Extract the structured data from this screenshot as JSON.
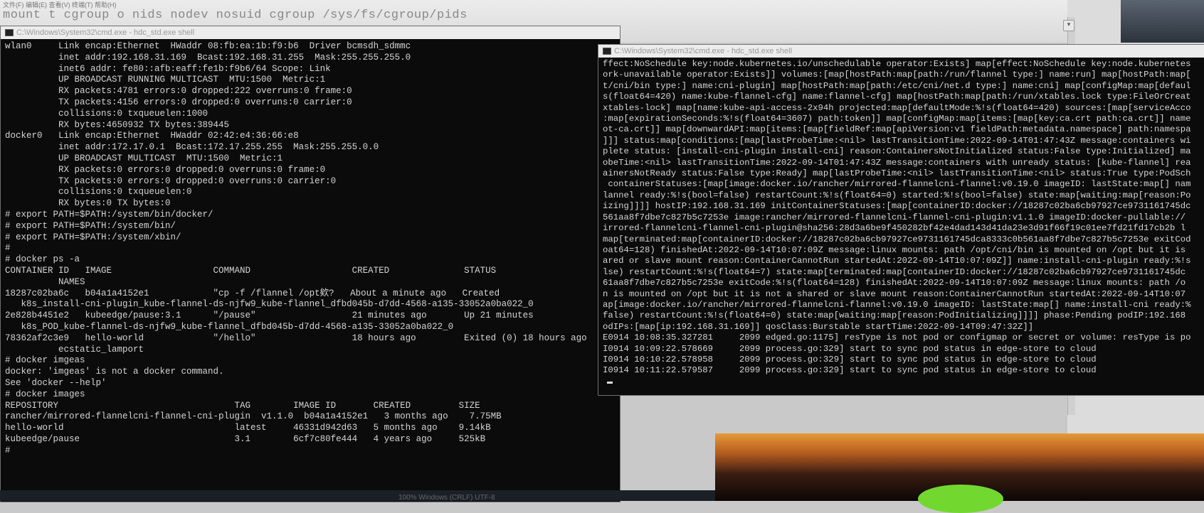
{
  "top": {
    "menu": "文件(F)  编辑(E)  查看(V)  终端(T)  帮助(H)",
    "command_line": "mount  t cgroup  o nids nodev nosuid cgroup /sys/fs/cgroup/pids"
  },
  "window1": {
    "title": "C:\\Windows\\System32\\cmd.exe - hdc_std.exe  shell",
    "lines": [
      "wlan0     Link encap:Ethernet  HWaddr 08:fb:ea:1b:f9:b6  Driver bcmsdh_sdmmc",
      "          inet addr:192.168.31.169  Bcast:192.168.31.255  Mask:255.255.255.0",
      "          inet6 addr: fe80::afb:eaff:fe1b:f9b6/64 Scope: Link",
      "          UP BROADCAST RUNNING MULTICAST  MTU:1500  Metric:1",
      "          RX packets:4781 errors:0 dropped:222 overruns:0 frame:0",
      "          TX packets:4156 errors:0 dropped:0 overruns:0 carrier:0",
      "          collisions:0 txqueuelen:1000",
      "          RX bytes:4650932 TX bytes:389445",
      "",
      "docker0   Link encap:Ethernet  HWaddr 02:42:e4:36:66:e8",
      "          inet addr:172.17.0.1  Bcast:172.17.255.255  Mask:255.255.0.0",
      "          UP BROADCAST MULTICAST  MTU:1500  Metric:1",
      "          RX packets:0 errors:0 dropped:0 overruns:0 frame:0",
      "          TX packets:0 errors:0 dropped:0 overruns:0 carrier:0",
      "          collisions:0 txqueuelen:0",
      "          RX bytes:0 TX bytes:0",
      "",
      "# export PATH=$PATH:/system/bin/docker/",
      "# export PATH=$PATH:/system/bin/",
      "# export PATH=$PATH:/system/xbin/",
      "#",
      "# docker ps -a",
      "CONTAINER ID   IMAGE                   COMMAND                   CREATED              STATUS",
      "          NAMES",
      "18287c02ba6c   b04a1a4152e1            \"cp -f /flannel /opt欸?   About a minute ago   Created",
      "   k8s_install-cni-plugin_kube-flannel-ds-njfw9_kube-flannel_dfbd045b-d7dd-4568-a135-33052a0ba022_0",
      "2e828b4451e2   kubeedge/pause:3.1      \"/pause\"                  21 minutes ago       Up 21 minutes",
      "   k8s_POD_kube-flannel-ds-njfw9_kube-flannel_dfbd045b-d7dd-4568-a135-33052a0ba022_0",
      "78362af2c3e9   hello-world             \"/hello\"                  18 hours ago         Exited (0) 18 hours ago",
      "          ecstatic_lamport",
      "# docker imgeas",
      "docker: 'imgeas' is not a docker command.",
      "See 'docker --help'",
      "# docker images",
      "REPOSITORY                                 TAG        IMAGE ID       CREATED         SIZE",
      "rancher/mirrored-flannelcni-flannel-cni-plugin  v1.1.0  b04a1a4152e1   3 months ago    7.75MB",
      "hello-world                                latest     46331d942d63   5 months ago    9.14kB",
      "kubeedge/pause                             3.1        6cf7c80fe444   4 years ago     525kB",
      "#"
    ]
  },
  "window2": {
    "title": "C:\\Windows\\System32\\cmd.exe - hdc_std.exe  shell",
    "lines": [
      "ffect:NoSchedule key:node.kubernetes.io/unschedulable operator:Exists] map[effect:NoSchedule key:node.kubernetes",
      "ork-unavailable operator:Exists]] volumes:[map[hostPath:map[path:/run/flannel type:] name:run] map[hostPath:map[",
      "t/cni/bin type:] name:cni-plugin] map[hostPath:map[path:/etc/cni/net.d type:] name:cni] map[configMap:map[defaul",
      "s(float64=420) name:kube-flannel-cfg] name:flannel-cfg] map[hostPath:map[path:/run/xtables.lock type:FileOrCreat",
      "xtables-lock] map[name:kube-api-access-2x94h projected:map[defaultMode:%!s(float64=420) sources:[map[serviceAcco",
      ":map[expirationSeconds:%!s(float64=3607) path:token]] map[configMap:map[items:[map[key:ca.crt path:ca.crt]] name",
      "ot-ca.crt]] map[downwardAPI:map[items:[map[fieldRef:map[apiVersion:v1 fieldPath:metadata.namespace] path:namespa",
      "]]] status:map[conditions:[map[lastProbeTime:<nil> lastTransitionTime:2022-09-14T01:47:43Z message:containers wi",
      "plete status: [install-cni-plugin install-cni] reason:ContainersNotInitialized status:False type:Initialized] ma",
      "obeTime:<nil> lastTransitionTime:2022-09-14T01:47:43Z message:containers with unready status: [kube-flannel] rea",
      "ainersNotReady status:False type:Ready] map[lastProbeTime:<nil> lastTransitionTime:<nil> status:True type:PodSch",
      " containerStatuses:[map[image:docker.io/rancher/mirrored-flannelcni-flannel:v0.19.0 imageID: lastState:map[] nam",
      "lannel ready:%!s(bool=false) restartCount:%!s(float64=0) started:%!s(bool=false) state:map[waiting:map[reason:Po",
      "izing]]]] hostIP:192.168.31.169 initContainerStatuses:[map[containerID:docker://18287c02ba6cb97927ce9731161745dc",
      "561aa8f7dbe7c827b5c7253e image:rancher/mirrored-flannelcni-flannel-cni-plugin:v1.1.0 imageID:docker-pullable://",
      "irrored-flannelcni-flannel-cni-plugin@sha256:28d3a6be9f450282bf42e4dad143d41da23e3d91f66f19c01ee7fd21fd17cb2b l",
      "map[terminated:map[containerID:docker://18287c02ba6cb97927ce9731161745dca8333c0b561aa8f7dbe7c827b5c7253e exitCod",
      "oat64=128) finishedAt:2022-09-14T10:07:09Z message:linux mounts: path /opt/cni/bin is mounted on /opt but it is",
      "ared or slave mount reason:ContainerCannotRun startedAt:2022-09-14T10:07:09Z]] name:install-cni-plugin ready:%!s",
      "lse) restartCount:%!s(float64=7) state:map[terminated:map[containerID:docker://18287c02ba6cb97927ce9731161745dc",
      "61aa8f7dbe7c827b5c7253e exitCode:%!s(float64=128) finishedAt:2022-09-14T10:07:09Z message:linux mounts: path /o",
      "n is mounted on /opt but it is not a shared or slave mount reason:ContainerCannotRun startedAt:2022-09-14T10:07",
      "ap[image:docker.io/rancher/mirrored-flannelcni-flannel:v0.19.0 imageID: lastState:map[] name:install-cni ready:%",
      "false) restartCount:%!s(float64=0) state:map[waiting:map[reason:PodInitializing]]]] phase:Pending podIP:192.168",
      "odIPs:[map[ip:192.168.31.169]] qosClass:Burstable startTime:2022-09-14T09:47:32Z]]",
      "E0914 10:08:35.327281     2099 edged.go:1175] resType is not pod or configmap or secret or volume: resType is po",
      "I0914 10:09:22.578669     2099 process.go:329] start to sync pod status in edge-store to cloud",
      "I0914 10:10:22.578958     2099 process.go:329] start to sync pod status in edge-store to cloud",
      "I0914 10:11:22.579587     2099 process.go:329] start to sync pod status in edge-store to cloud"
    ]
  },
  "taskbar": {
    "text": "100%    Windows (CRLF)    UTF-8"
  }
}
